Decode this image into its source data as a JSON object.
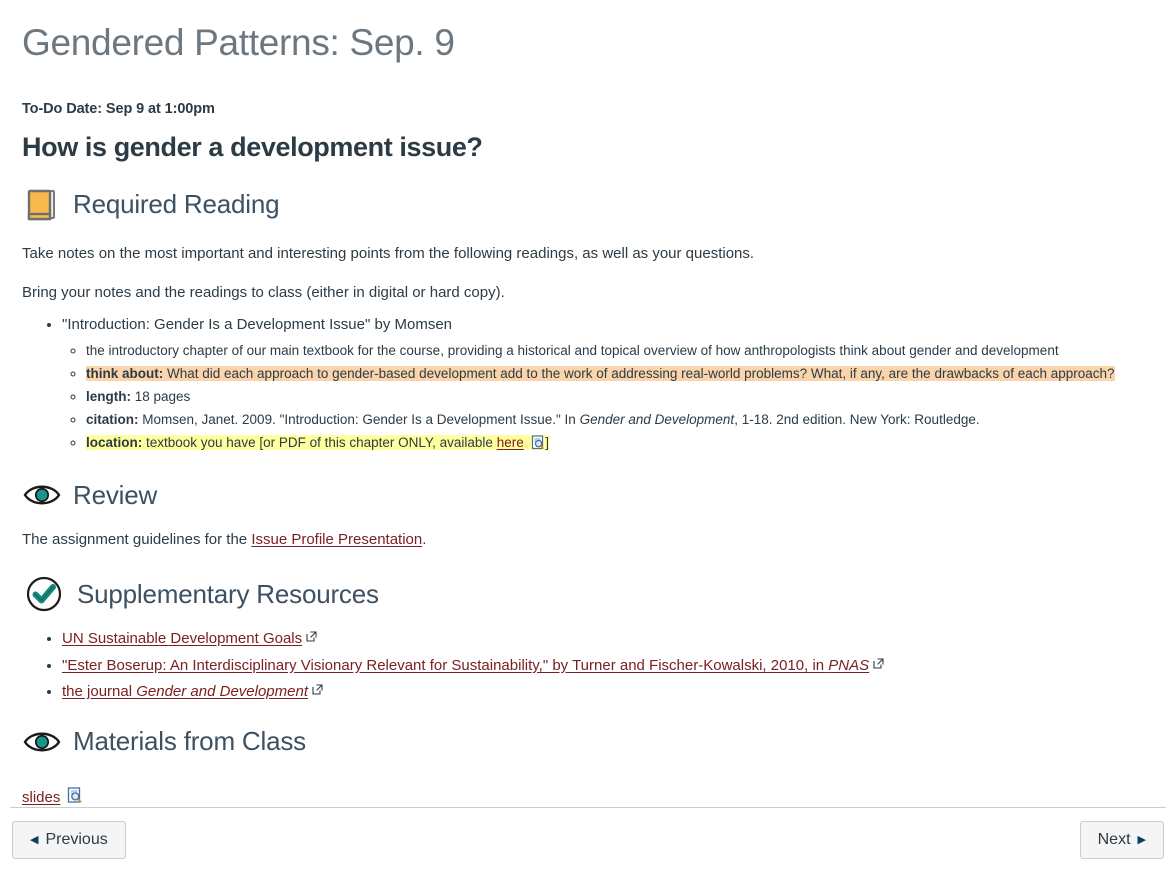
{
  "page": {
    "title": "Gendered Patterns: Sep. 9",
    "todo_date": "To-Do Date: Sep 9 at 1:00pm",
    "question_heading": "How is gender a development issue?"
  },
  "sections": {
    "required_reading": {
      "label": "Required Reading",
      "icon": "orange-book-icon",
      "paragraphs": [
        "Take notes on the most important and interesting points from the following readings, as well as your questions.",
        "Bring your notes and the readings to class (either in digital or hard copy)."
      ],
      "reading": {
        "title": "\"Introduction: Gender Is a Development Issue\" by Momsen",
        "details": {
          "overview": "the introductory chapter of our main textbook for the course, providing a historical and topical overview of how anthropologists think about gender and development",
          "think_about_label": "think about:",
          "think_about_text": " What did each approach to gender-based development add to the work of addressing real-world problems? What, if any,  are the drawbacks of each approach?",
          "length_label": "length:",
          "length_value": " 18 pages",
          "citation_label": "citation:",
          "citation_part1": " Momsen, Janet. 2009. \"Introduction: Gender Is a Development Issue.\" In ",
          "citation_italic": "Gender and Development",
          "citation_part2": ", 1-18. 2nd edition. New York: Routledge.",
          "location_label": "location:",
          "location_part1": " textbook you have [or PDF of this chapter ONLY, available ",
          "location_link": "here",
          "location_part2": "]"
        }
      }
    },
    "review": {
      "label": "Review",
      "icon": "eye-icon",
      "text_before": "The assignment guidelines for the ",
      "link": "Issue Profile Presentation",
      "text_after": "."
    },
    "supplementary_resources": {
      "label": "Supplementary Resources",
      "icon": "check-circle-icon",
      "links": [
        {
          "text": "UN Sustainable Development Goals",
          "italic_tail": "",
          "external": true
        },
        {
          "text": "\"Ester Boserup: An Interdisciplinary Visionary Relevant for Sustainability,\" by Turner and Fischer-Kowalski, 2010, in ",
          "italic_tail": "PNAS",
          "external": true
        },
        {
          "text": "the journal ",
          "italic_tail": "Gender and Development",
          "external": true
        }
      ]
    },
    "materials_from_class": {
      "label": "Materials from Class",
      "icon": "eye-icon",
      "slides_link": "slides",
      "slides_icon": "document-preview-icon"
    }
  },
  "footer": {
    "previous_label": "Previous",
    "next_label": "Next",
    "previous_arrow": "◀",
    "next_arrow": "▶"
  },
  "colors": {
    "highlight_orange": "#fbd4ac",
    "highlight_yellow": "#ffff9e",
    "link": "#7b2022",
    "heading": "#3d5162",
    "title": "#6c7780",
    "accent_teal": "#16968a",
    "book_orange": "#f8b84e"
  }
}
